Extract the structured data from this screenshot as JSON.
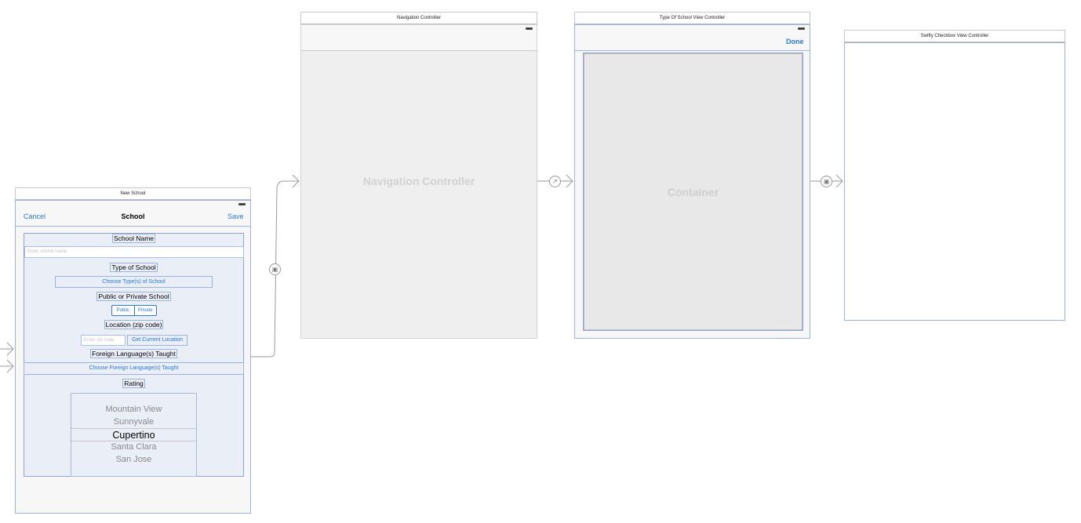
{
  "new_school": {
    "scene_title": "New School",
    "nav": {
      "cancel": "Cancel",
      "title": "School",
      "save": "Save"
    },
    "labels": {
      "school_name": "School Name",
      "school_name_placeholder": "Enter school name",
      "type_of_school": "Type of School",
      "choose_type": "Choose Type(s) of School",
      "public_private": "Public or Private School",
      "segment_public": "Public",
      "segment_private": "Private",
      "location": "Location (zip code)",
      "zip_placeholder": "Enter zip code",
      "get_location": "Get Current Location",
      "foreign_language": "Foreign Language(s) Taught",
      "choose_language": "Choose Foreign Language(s) Taught",
      "rating": "Rating"
    },
    "picker_items": [
      "Mountain View",
      "Sunnyvale",
      "Cupertino",
      "Santa Clara",
      "San Jose"
    ],
    "picker_selected": "Cupertino"
  },
  "navigation_controller": {
    "scene_title": "Navigation Controller",
    "placeholder": "Navigation Controller"
  },
  "type_of_school": {
    "scene_title": "Type Of School View Controller",
    "done": "Done",
    "container": "Container"
  },
  "swifty_checkbox": {
    "scene_title": "Swifty Checkbox View Controller"
  },
  "colors": {
    "accent": "#2a7ad9",
    "selection_border": "#9fb2db",
    "selection_fill": "#e9eef7",
    "placeholder_bg": "#efefef"
  }
}
